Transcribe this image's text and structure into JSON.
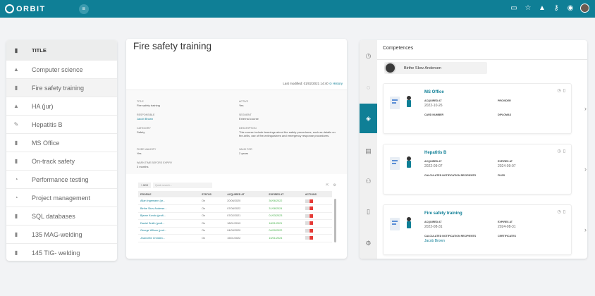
{
  "header": {
    "app_name": "ORBIT"
  },
  "left_list": {
    "title": "TITLE",
    "items": [
      {
        "label": "Computer science",
        "icon": "graduation-cap-icon"
      },
      {
        "label": "Fire safety training",
        "icon": "document-icon"
      },
      {
        "label": "HA (jur)",
        "icon": "graduation-cap-icon"
      },
      {
        "label": "Hepatitis B",
        "icon": "syringe-icon"
      },
      {
        "label": "MS Office",
        "icon": "document-icon"
      },
      {
        "label": "On-track safety",
        "icon": "document-icon"
      },
      {
        "label": "Performance testing",
        "icon": "gauge-icon"
      },
      {
        "label": "Project management",
        "icon": "gauge-icon"
      },
      {
        "label": "SQL databases",
        "icon": "document-icon"
      },
      {
        "label": "135 MAG-welding",
        "icon": "document-icon"
      },
      {
        "label": "145 TIG- welding",
        "icon": "document-icon"
      }
    ]
  },
  "detail": {
    "title": "Fire safety training",
    "last_modified_label": "Last modified: 01/02/2021 14:40",
    "history_label": "History",
    "fields": {
      "title_label": "TITLE",
      "title_value": "Fire safety training",
      "responsible_label": "RESPONSIBLE",
      "responsible_value": "Jacob Brown",
      "category_label": "CATEGORY",
      "category_value": "Safety",
      "active_label": "ACTIVE",
      "active_value": "Yes",
      "segment_label": "SEGMENT",
      "segment_value": "External course",
      "description_label": "DESCRIPTION",
      "description_value": "This course include learnings about fire safety procedures, such as details on fire-drills, use of fire-extinguishers and emergency response procedures.",
      "fixed_validity_label": "FIXED VALIDITY",
      "fixed_validity_value": "Yes",
      "valid_for_label": "VALID FOR",
      "valid_for_value": "2 years",
      "warn_label": "WARN TIME BEFORE EXPIRY",
      "warn_value": "3 months"
    },
    "table": {
      "add_label": "+ ADD",
      "search_placeholder": "Quick search...",
      "headers": [
        "PROFILE",
        "STATUS",
        "ACQUIRED AT",
        "EXPIRES AT",
        "ACTIONS"
      ],
      "rows": [
        {
          "profile": "Allan Ingemann (pr...",
          "status": "On",
          "acquired": "20/06/2020",
          "expires": "30/06/2022"
        },
        {
          "profile": "Birthe Skov Anderse...",
          "status": "On",
          "acquired": "07/08/2022",
          "expires": "31/08/2024"
        },
        {
          "profile": "Bjarne Kondo (profi...",
          "status": "On",
          "acquired": "07/02/2021",
          "expires": "01/03/2023"
        },
        {
          "profile": "Daniel Smith (profi...",
          "status": "On",
          "acquired": "18/01/2019",
          "expires": "18/01/2021"
        },
        {
          "profile": "George Wilson (prof...",
          "status": "On",
          "acquired": "04/09/2020",
          "expires": "04/09/2022"
        },
        {
          "profile": "Jeannette Christen...",
          "status": "On",
          "acquired": "15/01/2022",
          "expires": "15/01/2024"
        }
      ]
    }
  },
  "competences": {
    "title": "Competences",
    "person_name": "Birthe Skov Andersen",
    "cards": [
      {
        "title": "MS Office",
        "l1": "ACQUIRED AT",
        "v1": "2022-10-26",
        "l2": "PROVIDER",
        "v2": "",
        "l3": "CARD NUMBER",
        "v3": "",
        "l4": "DIPLOMAS",
        "v4": ""
      },
      {
        "title": "Hepatitis B",
        "l1": "ACQUIRED AT",
        "v1": "2022-09-07",
        "l2": "EXPIRES AT",
        "v2": "2024-09-07",
        "l3": "CALCULATED NOTIFICATION RECIPIENTS",
        "v3": "",
        "l4": "FILES",
        "v4": ""
      },
      {
        "title": "Fire safety training",
        "l1": "ACQUIRED AT",
        "v1": "2022-08-31",
        "l2": "EXPIRES AT",
        "v2": "2024-08-31",
        "l3": "CALCULATED NOTIFICATION RECIPIENTS",
        "v3": "Jacob Brown",
        "l4": "CERTIFICATES",
        "v4": ""
      }
    ]
  },
  "colors": {
    "brand": "#0f7f96",
    "date_ok": "#46b04a",
    "delete": "#e53935"
  }
}
